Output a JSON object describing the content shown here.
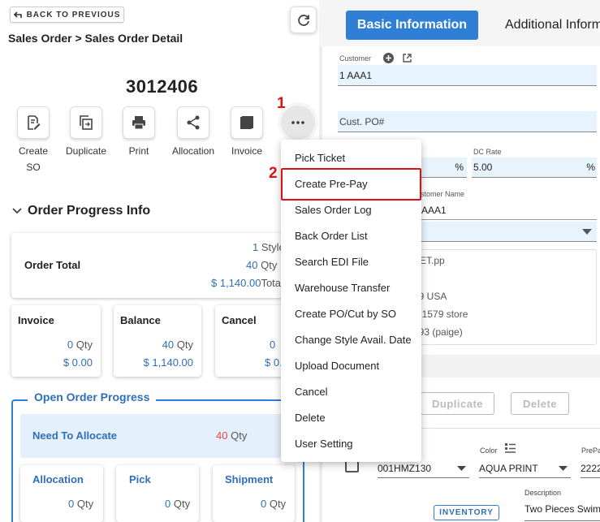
{
  "header": {
    "back_label": "BACK TO PREVIOUS",
    "breadcrumb": "Sales Order > Sales Order Detail",
    "order_number": "3012406"
  },
  "actions": [
    {
      "label": "Create",
      "label2": "SO",
      "icon": "edit-doc-icon"
    },
    {
      "label": "Duplicate",
      "icon": "copy-icon"
    },
    {
      "label": "Print",
      "icon": "printer-icon"
    },
    {
      "label": "Allocation",
      "icon": "share-icon"
    },
    {
      "label": "Invoice",
      "icon": "invoice-icon"
    }
  ],
  "annotations": {
    "mark1": "1",
    "mark2": "2"
  },
  "order_progress": {
    "title": "Order Progress Info",
    "order_total_label": "Order Total",
    "styles": "1",
    "styles_unit": "Style",
    "qty": "40",
    "qty_unit": "Qty",
    "amount": "$ 1,140.00",
    "amount_unit": "Total",
    "invoice": {
      "label": "Invoice",
      "qty": "0",
      "amount": "$ 0.00"
    },
    "balance": {
      "label": "Balance",
      "qty": "40",
      "amount": "$ 1,140.00"
    },
    "cancel": {
      "label": "Cancel",
      "qty": "0",
      "amount": "$ 0."
    }
  },
  "open_order": {
    "title": "Open Order Progress",
    "need_label": "Need To Allocate",
    "need_qty": "40",
    "qty_unit": "Qty",
    "items": [
      {
        "label": "Allocation",
        "qty": "0"
      },
      {
        "label": "Pick",
        "qty": "0"
      },
      {
        "label": "Shipment",
        "qty": "0"
      }
    ]
  },
  "right": {
    "tab_basic": "Basic Information",
    "tab_additional": "Additional Inform",
    "customer_label": "Customer",
    "customer_value": "1 AAA1",
    "cust_po_placeholder": "Cust. PO#",
    "dc_rate_label": "DC Rate",
    "dc_rate_value": "5.00",
    "pct": "%",
    "customer_name_label": "ustomer Name",
    "customer_name_value": "AAA1",
    "addr1": "EET.pp",
    "addr2": "39 USA",
    "addr3": "3-1579 store",
    "addr4": "493 (paige)",
    "duplicate": "Duplicate",
    "delete": "Delete",
    "color_label": "Color",
    "prepack_label": "PrePa",
    "style_value": "001HMZ130",
    "color_value": "AQUA PRINT",
    "prepack_value": "2222",
    "inventory": "INVENTORY",
    "description_label": "Description",
    "description_value": "Two Pieces Swim"
  },
  "menu": [
    "Pick Ticket",
    "Create Pre-Pay",
    "Sales Order Log",
    "Back Order List",
    "Search EDI File",
    "Warehouse Transfer",
    "Create PO/Cut by SO",
    "Change Style Avail. Date",
    "Upload Document",
    "Cancel",
    "Delete",
    "User Setting"
  ],
  "colors": {
    "accent": "#2f7fd6",
    "highlight": "#dd1111",
    "qty_red": "#e04848"
  }
}
